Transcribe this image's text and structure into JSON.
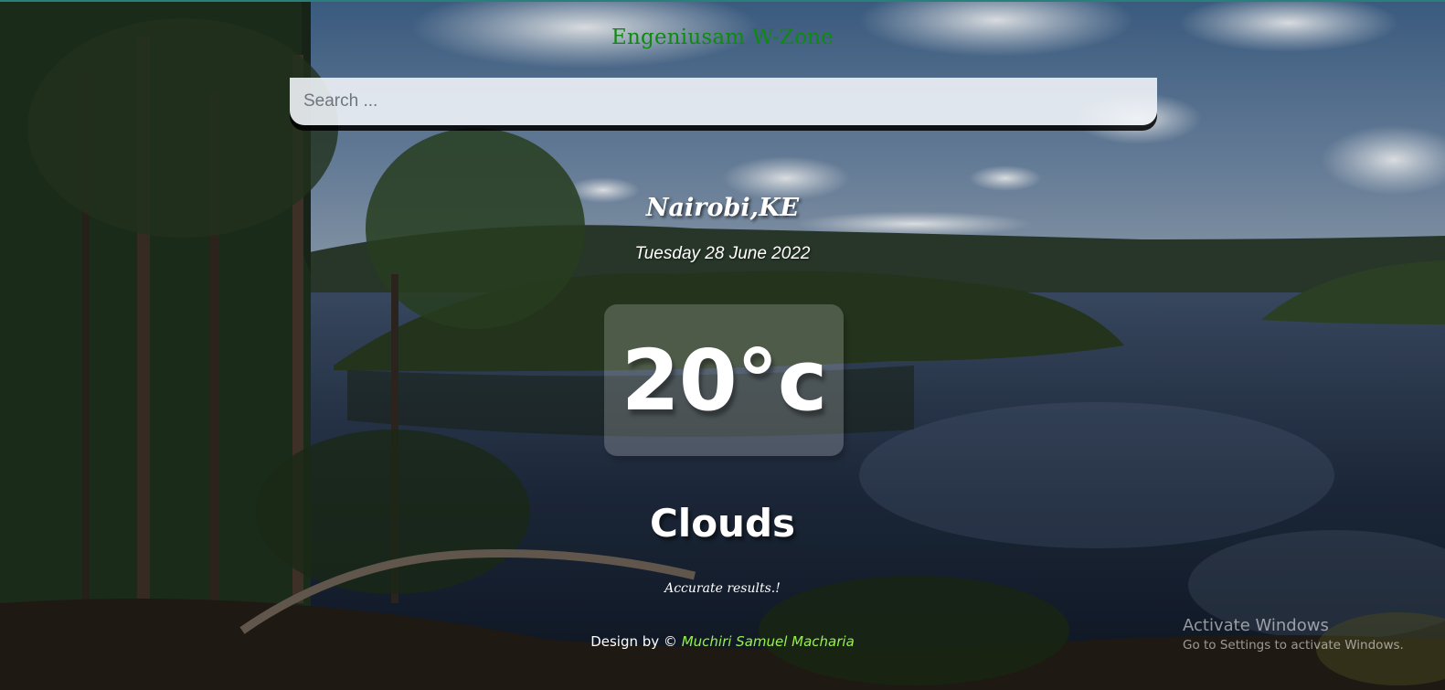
{
  "app": {
    "brand": "Engeniusam W-Zone"
  },
  "search": {
    "placeholder": "Search ...",
    "value": ""
  },
  "weather": {
    "location": "Nairobi,KE",
    "date": "Tuesday 28 June 2022",
    "temperature": "20°c",
    "condition": "Clouds",
    "note": "Accurate results.!"
  },
  "footer": {
    "prefix": "Design by © ",
    "author": "Muchiri Samuel Macharia"
  },
  "watermark": {
    "title": "Activate Windows",
    "subtitle": "Go to Settings to activate Windows."
  },
  "colors": {
    "brand": "#0f8a11",
    "author": "#9af04a",
    "text": "#ffffff"
  }
}
